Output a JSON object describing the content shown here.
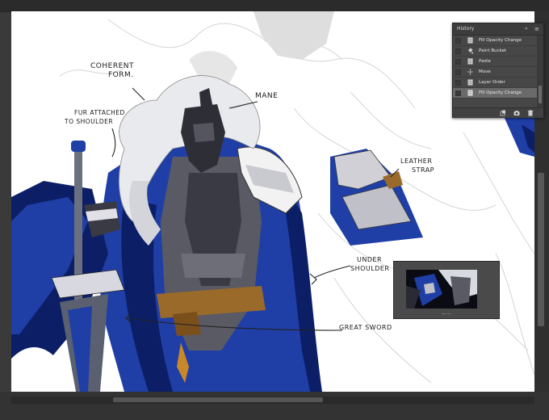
{
  "history_panel": {
    "tab_label": "History",
    "collapse_glyph": "»",
    "menu_glyph": "≡",
    "items": [
      {
        "label": "Fill Opacity Change",
        "icon": "doc-icon"
      },
      {
        "label": "Paint Bucket",
        "icon": "bucket-icon"
      },
      {
        "label": "Paste",
        "icon": "doc-icon"
      },
      {
        "label": "Move",
        "icon": "move-icon"
      },
      {
        "label": "Layer Order",
        "icon": "doc-icon"
      },
      {
        "label": "Fill Opacity Change",
        "icon": "doc-icon",
        "active": true
      }
    ],
    "footer_icons": [
      "new-document-from-state-icon",
      "camera-snapshot-icon",
      "trash-icon"
    ]
  },
  "annotations": {
    "coherent_form": [
      "COHERENT",
      "FORM."
    ],
    "mane": "MANE",
    "fur_attached": [
      "FUR ATTACHED",
      "TO SHOULDER"
    ],
    "leather_strap": [
      "LEATHER",
      "STRAP"
    ],
    "under_shoulder": [
      "UNDER",
      "SHOULDER"
    ],
    "great_sword": "GREAT SWORD"
  },
  "colors": {
    "cape_blue": "#1f3fa6",
    "deep_blue": "#0c1f66",
    "armor_gray": "#5a5a64",
    "belt_brown": "#9a6a2a",
    "hair_white": "#e9eaee",
    "panel_bg": "#474747",
    "active_row": "#6a6a6a"
  }
}
